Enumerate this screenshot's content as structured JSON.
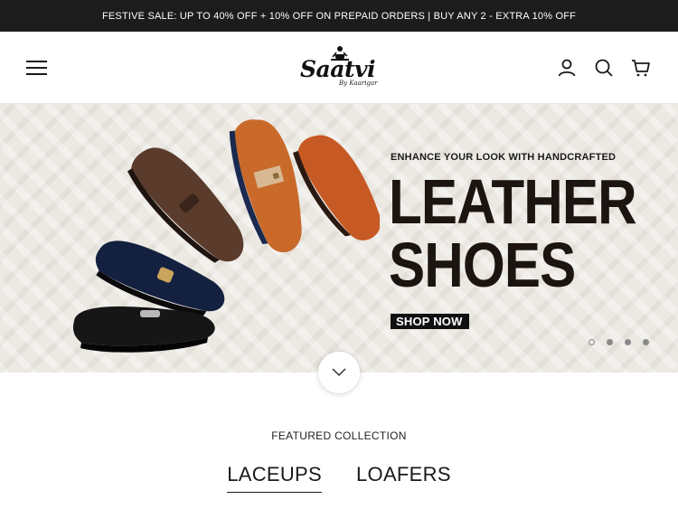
{
  "announcement": "FESTIVE SALE: UP TO 40% OFF + 10% OFF ON PREPAID ORDERS | BUY ANY 2 - EXTRA 10% OFF",
  "header": {
    "logo_text": "Saatvi",
    "logo_subtext": "By Kaarigar",
    "icons": [
      "menu-icon",
      "account-icon",
      "search-icon",
      "cart-icon"
    ]
  },
  "hero": {
    "eyebrow": "ENHANCE YOUR LOOK WITH HANDCRAFTED",
    "headline_line1": "LEATHER",
    "headline_line2": "SHOES",
    "cta": "SHOP NOW",
    "slides_total": 4,
    "active_slide": 1
  },
  "featured": {
    "heading": "FEATURED COLLECTION",
    "tabs": [
      {
        "label": "LACEUPS",
        "active": true
      },
      {
        "label": "LOAFERS",
        "active": false
      }
    ]
  },
  "colors": {
    "announce_bg": "#1c1c1c",
    "headline": "#1c1410",
    "hero_bg": "#ece9e3"
  }
}
